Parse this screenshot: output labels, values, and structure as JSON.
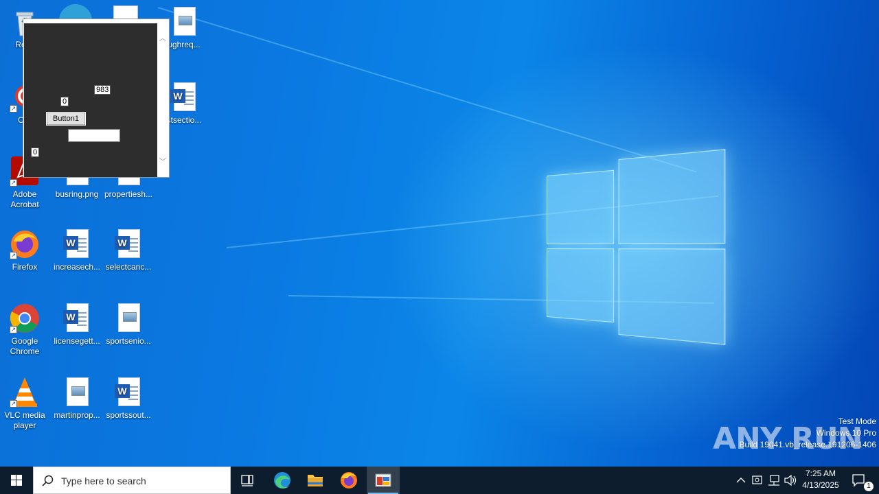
{
  "desktop": {
    "icons": [
      {
        "label": "Recy",
        "kind": "recycle"
      },
      {
        "label": "CCl",
        "kind": "ccleaner"
      },
      {
        "label": "Adobe Acrobat",
        "kind": "acrobat"
      },
      {
        "label": "Firefox",
        "kind": "firefox"
      },
      {
        "label": "Google Chrome",
        "kind": "chrome"
      },
      {
        "label": "VLC media player",
        "kind": "vlc"
      },
      {
        "label": "busring.png",
        "kind": "image"
      },
      {
        "label": "increasech...",
        "kind": "word"
      },
      {
        "label": "licensegett...",
        "kind": "word"
      },
      {
        "label": "martinprop...",
        "kind": "image"
      },
      {
        "label": "propertiesh...",
        "kind": "word"
      },
      {
        "label": "selectcanc...",
        "kind": "word"
      },
      {
        "label": "sportsenio...",
        "kind": "image"
      },
      {
        "label": "sportssout...",
        "kind": "word"
      },
      {
        "label": "ughreq...",
        "kind": "image"
      },
      {
        "label": "stsectio...",
        "kind": "word"
      }
    ]
  },
  "app_window": {
    "label_983": "983",
    "label_0a": "0",
    "label_0b": "0",
    "button1": "Button1",
    "textbox_value": ""
  },
  "watermark": {
    "logo": "ANY RUN",
    "line1": "Test Mode",
    "line2": "Windows 10 Pro",
    "line3": "Build 19041.vb_release.191206-1406"
  },
  "taskbar": {
    "search_placeholder": "Type here to search",
    "time": "7:25 AM",
    "date": "4/13/2025",
    "notification_count": "1",
    "pinned": [
      "Task View",
      "Microsoft Edge",
      "File Explorer",
      "Firefox",
      "Running app"
    ]
  }
}
